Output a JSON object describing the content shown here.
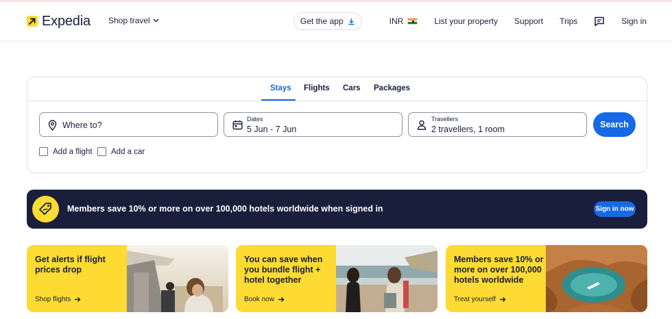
{
  "brand": {
    "name": "Expedia",
    "accent": "#fddb32",
    "primary_blue": "#1668e3",
    "navy": "#191e3b"
  },
  "header": {
    "shop_travel": "Shop travel",
    "get_app": "Get the app",
    "currency": "INR",
    "list_property": "List your property",
    "support": "Support",
    "trips": "Trips",
    "sign_in": "Sign in"
  },
  "search": {
    "tabs": [
      {
        "label": "Stays",
        "active": true
      },
      {
        "label": "Flights",
        "active": false
      },
      {
        "label": "Cars",
        "active": false
      },
      {
        "label": "Packages",
        "active": false
      }
    ],
    "destination": {
      "placeholder": "Where to?"
    },
    "dates": {
      "label": "Dates",
      "value": "5 Jun - 7 Jun"
    },
    "travellers": {
      "label": "Travellers",
      "value": "2 travellers, 1 room"
    },
    "search_button": "Search",
    "add_flight": {
      "label": "Add a flight",
      "checked": false
    },
    "add_car": {
      "label": "Add a car",
      "checked": false
    }
  },
  "banner": {
    "text": "Members save 10% or more on over 100,000 hotels worldwide when signed in",
    "button": "Sign in now"
  },
  "promos": [
    {
      "text": "Get alerts if flight prices drop",
      "link": "Shop flights",
      "image": "plane-and-traveller"
    },
    {
      "text": "You can save when you bundle flight + hotel together",
      "link": "Book now",
      "image": "beach-walk"
    },
    {
      "text": "Members save 10% or more on over 100,000 hotels worldwide",
      "link": "Treat yourself",
      "image": "sea-cave-boat"
    }
  ]
}
